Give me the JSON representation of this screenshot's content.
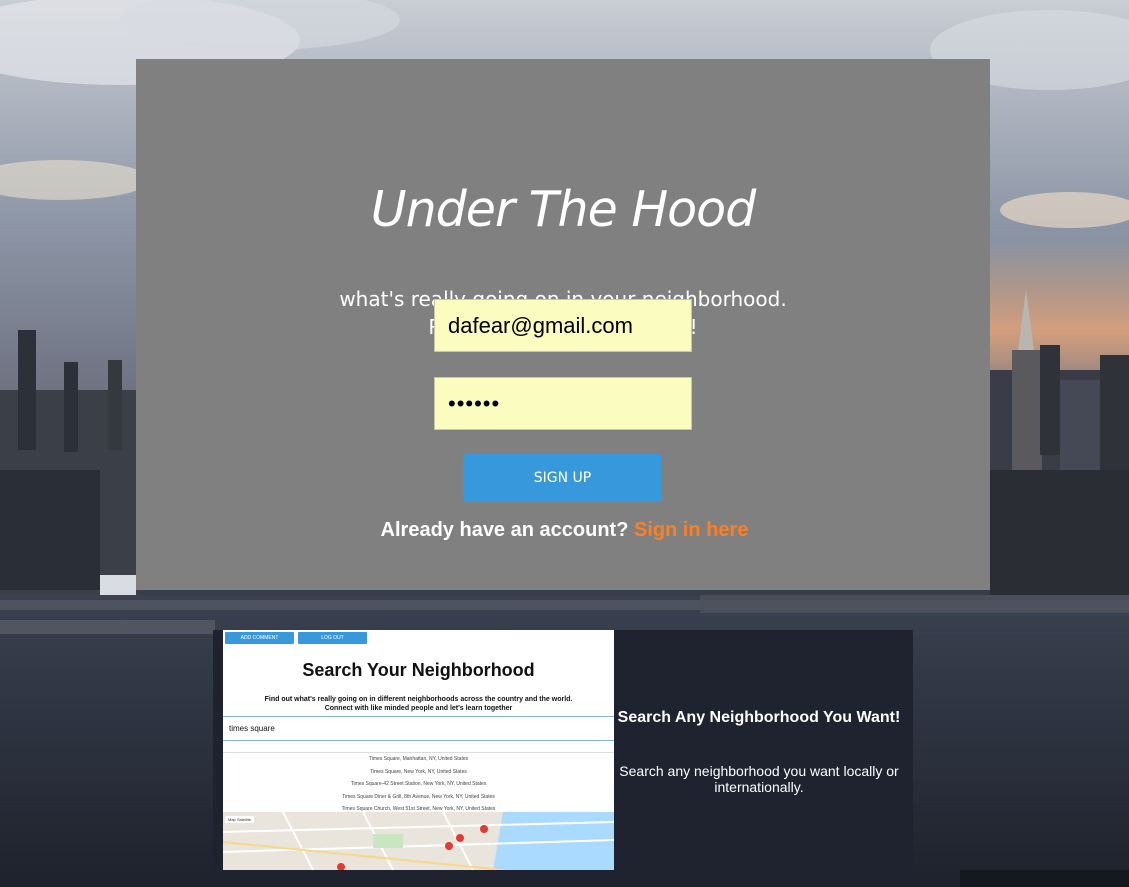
{
  "signup": {
    "title": "Under The Hood",
    "subtitle_line1": "what's really going on in your neighborhood.",
    "subtitle_line2": "Register here and find out!",
    "email_value": "dafear@gmail.com",
    "password_value": "••••••",
    "signup_button": "SIGN UP",
    "already_text": "Already have an account?",
    "signin_link": "Sign in here"
  },
  "preview": {
    "add_comment": "ADD COMMENT",
    "log_out": "LOG OUT",
    "title": "Search Your Neighborhood",
    "desc_line1": "Find out what's really going on in different neighborhoods across the country and the world.",
    "desc_line2": "Connect with like minded people and let's learn together",
    "search_value": "times square",
    "results": [
      "Times Square, Manhattan, NY, United States",
      "Times Square, New York, NY, United States",
      "Times Square-42 Street Station, New York, NY, United States",
      "Times Square Diner & Grill, 8th Avenue, New York, NY, United States",
      "Times Square Church, West 51st Street, New York, NY, United States"
    ],
    "map_tabs": "Map   Satellite"
  },
  "feature": {
    "heading": "Search Any Neighborhood You Want!",
    "text": "Search any neighborhood you want locally or internationally."
  },
  "colors": {
    "card": "#808080",
    "field": "#fbfcc0",
    "button": "#3898dc",
    "link": "#ff7f1f"
  }
}
